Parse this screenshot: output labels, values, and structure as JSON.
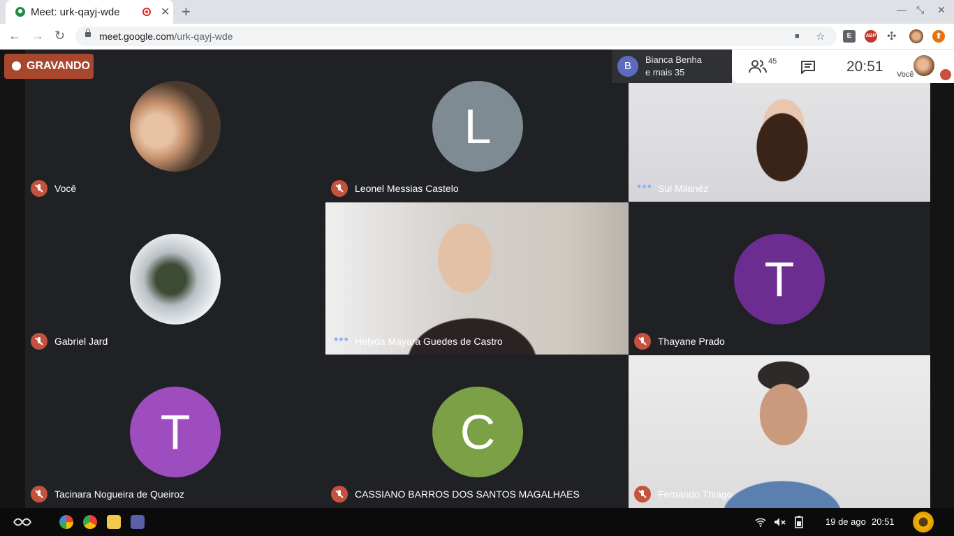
{
  "browser": {
    "tab_title": "Meet: urk-qayj-wde",
    "tab_close": "✕",
    "new_tab": "+",
    "url_domain": "meet.google.com",
    "url_path": "/urk-qayj-wde",
    "win_min": "—",
    "win_restore": "⤡",
    "win_close": "✕",
    "back": "←",
    "forward": "→",
    "reload": "↻",
    "ext_e": "E",
    "ext_abp": "ABP",
    "cam_icon": "■",
    "star_icon": "☆",
    "puzzle_icon": "✣",
    "update_icon": "⬆"
  },
  "meet": {
    "recording_label": "GRAVANDO",
    "presenter_initial": "B",
    "presenter_name": "Bianca Benha",
    "presenter_more": "e mais 35",
    "people_count": "45",
    "clock": "20:51",
    "you_label": "Você",
    "tiles": [
      {
        "name": "Você"
      },
      {
        "name": "Leonel Messias Castelo",
        "initial": "L"
      },
      {
        "name": "Sul Milanêz"
      },
      {
        "name": "Gabriel Jard"
      },
      {
        "name": "Helyda Mayara Guedes de Castro"
      },
      {
        "name": "Thayane Prado",
        "initial": "T"
      },
      {
        "name": "Tacinara Nogueira de Queiroz",
        "initial": "T"
      },
      {
        "name": "CASSIANO BARROS DOS SANTOS MAGALHAES",
        "initial": "C"
      },
      {
        "name": "Fernando Thiago"
      }
    ],
    "speaking_dots": "•••"
  },
  "taskbar": {
    "date": "19 de ago",
    "time": "20:51"
  },
  "colors": {
    "meet_bg": "#202124",
    "recording": "#a7482e",
    "avatar_gray": "#7e8b92",
    "avatar_purple": "#6b2d8f",
    "avatar_violet": "#9d4dbd",
    "avatar_green": "#7ca046",
    "mute_red": "#c5523d"
  }
}
